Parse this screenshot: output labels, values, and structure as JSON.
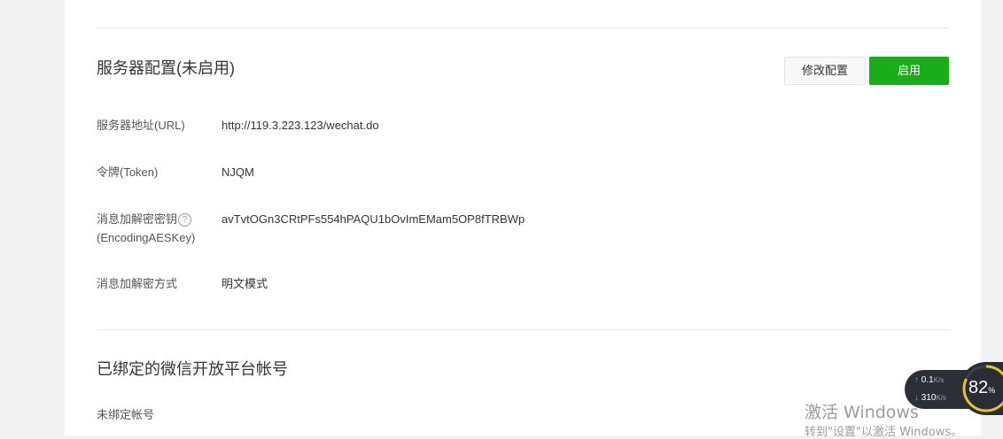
{
  "server_config": {
    "title": "服务器配置(未启用)",
    "modify_button": "修改配置",
    "enable_button": "启用",
    "rows": [
      {
        "label": "服务器地址(URL)",
        "value": "http://119.3.223.123/wechat.do"
      },
      {
        "label": "令牌(Token)",
        "value": "NJQM"
      },
      {
        "label_line1": "消息加解密密钥",
        "label_line2": "(EncodingAESKey)",
        "help": "?",
        "value": "avTvtOGn3CRtPFs554hPAQU1bOvImEMam5OP8fTRBWp"
      },
      {
        "label": "消息加解密方式",
        "value": "明文模式"
      }
    ]
  },
  "bound_accounts": {
    "title": "已绑定的微信开放平台帐号",
    "status": "未绑定帐号"
  },
  "windows_watermark": {
    "line1": "激活 Windows",
    "line2": "转到\"设置\"以激活 Windows。"
  },
  "net_monitor": {
    "upload": "0.1",
    "download": "310",
    "unit": "K/s",
    "percent": "82",
    "percent_sign": "%",
    "up_icon": "arrow-up-icon",
    "down_icon": "arrow-down-icon"
  },
  "colors": {
    "accent_green": "#1aad19",
    "gauge_ring": "#e3c23a"
  }
}
